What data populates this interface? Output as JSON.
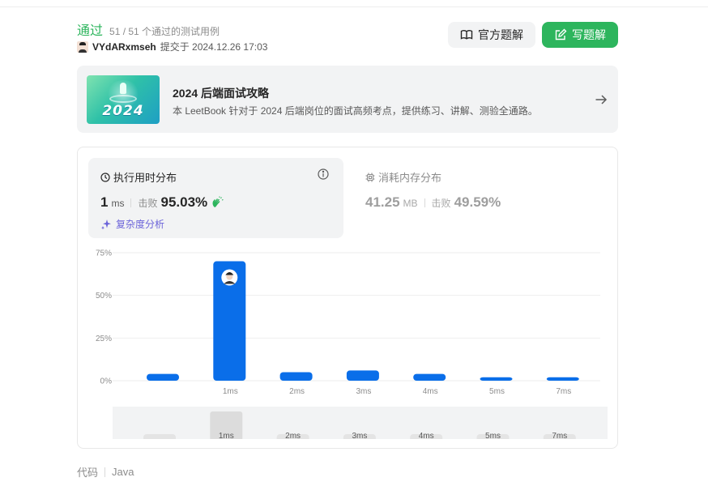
{
  "status": {
    "result": "通过",
    "cases": "51 / 51 个通过的测试用例"
  },
  "submission": {
    "username": "VYdARxmseh",
    "submitted_at": "提交于 2024.12.26 17:03"
  },
  "actions": {
    "official_solution": "官方题解",
    "write_solution": "写题解"
  },
  "banner": {
    "art_text": "2024",
    "title": "2024 后端面试攻略",
    "description": "本 LeetBook 针对于 2024 后端岗位的面试高频考点，提供练习、讲解、测验全通路。"
  },
  "runtime": {
    "title": "执行用时分布",
    "value": "1",
    "unit": "ms",
    "beat_label": "击败",
    "beat_percent": "95.03%",
    "complexity_link": "复杂度分析"
  },
  "memory": {
    "title": "消耗内存分布",
    "value": "41.25",
    "unit": "MB",
    "beat_label": "击败",
    "beat_percent": "49.59%"
  },
  "chart_data": {
    "type": "bar",
    "categories": [
      "",
      "1ms",
      "2ms",
      "3ms",
      "4ms",
      "5ms",
      "7ms"
    ],
    "values": [
      4,
      70,
      5,
      6,
      4,
      2,
      2
    ],
    "ylim": [
      0,
      75
    ],
    "yticks": [
      "0%",
      "25%",
      "50%",
      "75%"
    ],
    "ytick_values": [
      0,
      25,
      50,
      75
    ],
    "highlight_index": 1,
    "grid": true,
    "bar_color": "#0a6ee9"
  },
  "navigator": {
    "categories": [
      "",
      "1ms",
      "2ms",
      "3ms",
      "4ms",
      "5ms",
      "7ms"
    ],
    "selected_index": 1
  },
  "code": {
    "label": "代码",
    "language": "Java"
  },
  "colors": {
    "accent_green": "#2db55d",
    "bar_blue": "#0a6ee9",
    "complexity_purple": "#6b63d9"
  }
}
